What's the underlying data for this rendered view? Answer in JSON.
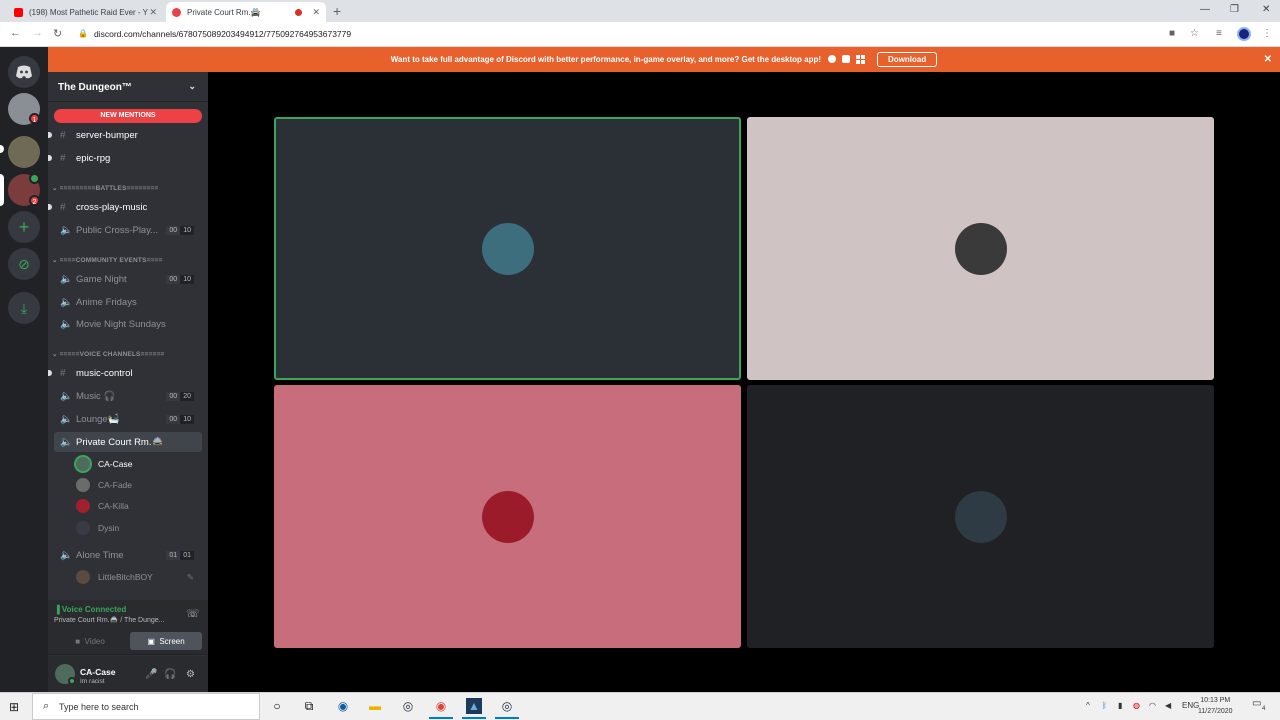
{
  "browser": {
    "tabs": [
      {
        "title": "(198) Most Pathetic Raid Ever - Y",
        "close": "✕",
        "favicon_color": "#ff0000"
      },
      {
        "title": "Private Court Rm.🚔",
        "close": "✕",
        "favicon_color": "#ed4245"
      }
    ],
    "new_tab": "+",
    "url": "discord.com/channels/678075089203494912/775092764953673779",
    "window_controls": [
      "—",
      "❐",
      "✕"
    ]
  },
  "banner": {
    "text": "Want to take full advantage of Discord with better performance, in-game overlay, and more? Get the desktop app!",
    "platforms": "  ",
    "download_label": "Download",
    "close": "✕"
  },
  "server_rail": {
    "home_icon": "discord-icon",
    "badges": [
      "1",
      "2"
    ],
    "add_label": "+",
    "explore_label": "⊘",
    "download_label": "⤓"
  },
  "guild": {
    "name": "The Dungeon™",
    "chevron": "⌄",
    "new_mentions": "NEW MENTIONS"
  },
  "channels": [
    {
      "name": "server-bumper",
      "type": "text",
      "unread": true
    },
    {
      "name": "epic-rpg",
      "type": "text",
      "unread": true
    }
  ],
  "categories": {
    "battles": "=========BATTLES========",
    "community": "====COMMUNITY EVENTS====",
    "voice": "=====VOICE CHANNELS======"
  },
  "battles_channels": [
    {
      "name": "cross-play-music",
      "type": "text",
      "unread": true
    },
    {
      "name": "Public Cross-Play...",
      "type": "voice",
      "count_a": "00",
      "count_b": "10"
    }
  ],
  "community_channels": [
    {
      "name": "Game Night",
      "type": "voice",
      "count_a": "00",
      "count_b": "10"
    },
    {
      "name": "Anime Fridays",
      "type": "voice"
    },
    {
      "name": "Movie Night Sundays",
      "type": "voice"
    }
  ],
  "voice_channels": [
    {
      "name": "music-control",
      "type": "text",
      "unread": true
    },
    {
      "name": "Music 🎧",
      "type": "voice",
      "count_a": "00",
      "count_b": "20"
    },
    {
      "name": "Lounge🛀",
      "type": "voice",
      "count_a": "00",
      "count_b": "10"
    },
    {
      "name": "Private Court Rm.🚔",
      "type": "voice",
      "active": true
    }
  ],
  "private_court_members": [
    {
      "name": "CA-Case",
      "color": "#4e6b5e",
      "me": true
    },
    {
      "name": "CA-Fade",
      "color": "#6b6b6b"
    },
    {
      "name": "CA-Killa",
      "color": "#a02030"
    },
    {
      "name": "Dysin",
      "color": "#3a3a45"
    }
  ],
  "alone_time": {
    "name": "Alone Time",
    "count_a": "01",
    "count_b": "01"
  },
  "alone_time_members": [
    {
      "name": "LittleBitchBOY",
      "color": "#5a4a40",
      "muted_icon": "✎"
    }
  ],
  "voice_panel": {
    "status": "Voice Connected",
    "channel": "Private Court Rm.🚔 / The Dunge...",
    "video_label": "Video",
    "screen_label": "Screen"
  },
  "user_panel": {
    "name": "CA-Case",
    "status": "Im racist"
  },
  "video_tiles": [
    {
      "bg": "#2b3036",
      "avatar_color": "#3d6e7e",
      "speaking": true
    },
    {
      "bg": "#cfc3c3",
      "avatar_color": "#3a3a3a",
      "speaking": false
    },
    {
      "bg": "#c76d7c",
      "avatar_color": "#9b1b2a",
      "speaking": false
    },
    {
      "bg": "#202125",
      "avatar_color": "#2f3b44",
      "speaking": false
    }
  ],
  "taskbar": {
    "search_placeholder": "Type here to search",
    "language": "ENG",
    "time": "10:13 PM",
    "date": "11/27/2020",
    "notifications": "4"
  }
}
